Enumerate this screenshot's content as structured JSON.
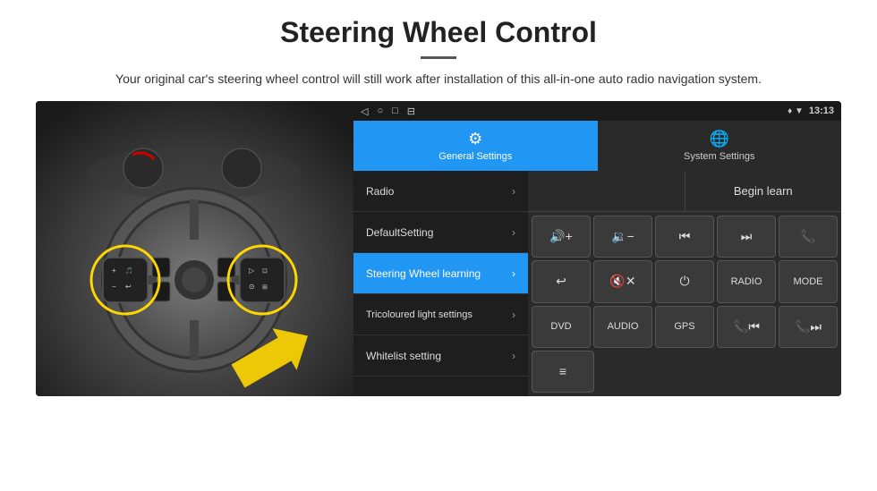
{
  "page": {
    "title": "Steering Wheel Control",
    "subtitle": "Your original car's steering wheel control will still work after installation of this all-in-one auto radio navigation system."
  },
  "status_bar": {
    "time": "13:13",
    "back_icon": "◁",
    "circle_icon": "○",
    "square_icon": "□",
    "menu_icon": "⊟"
  },
  "tabs": [
    {
      "id": "general",
      "label": "General Settings",
      "icon": "⚙",
      "active": true
    },
    {
      "id": "system",
      "label": "System Settings",
      "icon": "🌐",
      "active": false
    }
  ],
  "menu_items": [
    {
      "id": "radio",
      "label": "Radio",
      "active": false
    },
    {
      "id": "default",
      "label": "DefaultSetting",
      "active": false
    },
    {
      "id": "steering",
      "label": "Steering Wheel learning",
      "active": true
    },
    {
      "id": "tricoloured",
      "label": "Tricoloured light settings",
      "active": false
    },
    {
      "id": "whitelist",
      "label": "Whitelist setting",
      "active": false
    }
  ],
  "right_panel": {
    "begin_learn_label": "Begin learn",
    "button_rows": [
      [
        {
          "id": "vol_up",
          "label": "🔊+",
          "type": "icon"
        },
        {
          "id": "vol_down",
          "label": "🔉−",
          "type": "icon"
        },
        {
          "id": "prev_track",
          "label": "⏮",
          "type": "icon"
        },
        {
          "id": "next_track",
          "label": "⏭",
          "type": "icon"
        },
        {
          "id": "phone",
          "label": "📞",
          "type": "icon"
        }
      ],
      [
        {
          "id": "end_call",
          "label": "↩",
          "type": "icon"
        },
        {
          "id": "mute",
          "label": "🔇x",
          "type": "icon"
        },
        {
          "id": "power",
          "label": "⏻",
          "type": "icon"
        },
        {
          "id": "radio_btn",
          "label": "RADIO",
          "type": "text"
        },
        {
          "id": "mode_btn",
          "label": "MODE",
          "type": "text"
        }
      ],
      [
        {
          "id": "dvd_btn",
          "label": "DVD",
          "type": "text"
        },
        {
          "id": "audio_btn",
          "label": "AUDIO",
          "type": "text"
        },
        {
          "id": "gps_btn",
          "label": "GPS",
          "type": "text"
        },
        {
          "id": "tel_prev",
          "label": "📞⏮",
          "type": "icon"
        },
        {
          "id": "tel_next",
          "label": "📞⏭",
          "type": "icon"
        }
      ],
      [
        {
          "id": "media_btn",
          "label": "≡",
          "type": "icon"
        }
      ]
    ]
  }
}
